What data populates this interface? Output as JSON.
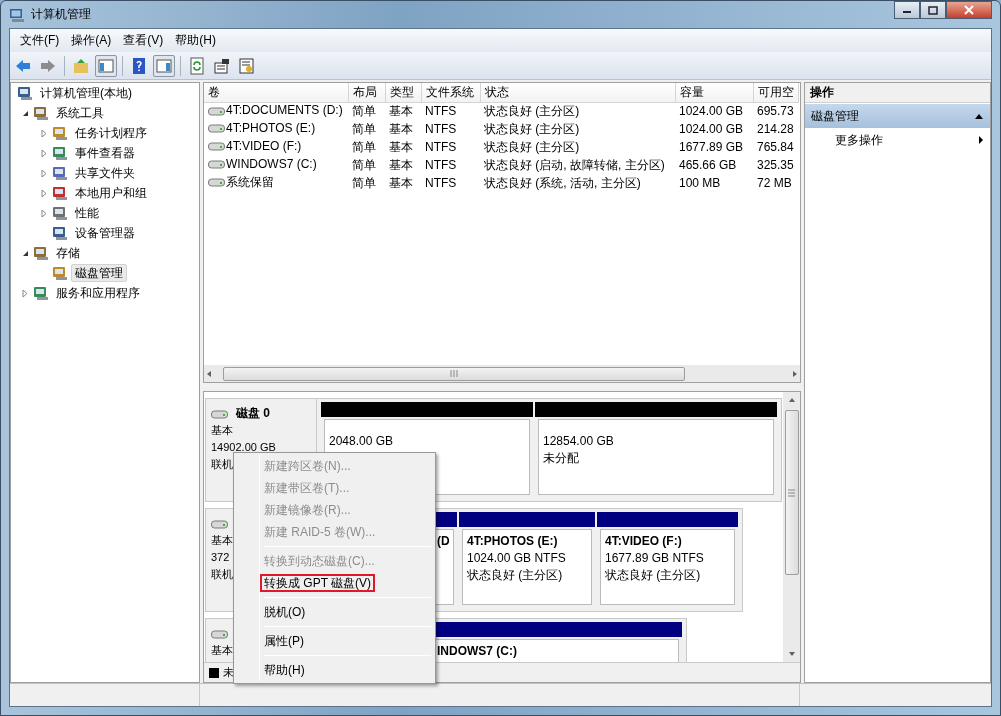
{
  "window": {
    "title": "计算机管理"
  },
  "menu_bar": [
    {
      "label": "文件(F)"
    },
    {
      "label": "操作(A)"
    },
    {
      "label": "查看(V)"
    },
    {
      "label": "帮助(H)"
    }
  ],
  "toolbar": [
    {
      "kind": "back",
      "pressed": false
    },
    {
      "kind": "forward",
      "pressed": false
    },
    {
      "kind": "sep"
    },
    {
      "kind": "up",
      "pressed": false
    },
    {
      "kind": "tree",
      "pressed": true
    },
    {
      "kind": "sep"
    },
    {
      "kind": "help",
      "pressed": false
    },
    {
      "kind": "pane",
      "pressed": true
    },
    {
      "kind": "sep"
    },
    {
      "kind": "refresh",
      "pressed": false
    },
    {
      "kind": "properties",
      "pressed": false
    },
    {
      "kind": "export",
      "pressed": false
    }
  ],
  "tree": [
    {
      "label": "计算机管理(本地)",
      "kind": "root",
      "selected": false,
      "children": [
        {
          "label": "系统工具",
          "kind": "branch",
          "expanded": true,
          "selected": false,
          "children": [
            {
              "label": "任务计划程序",
              "kind": "branch",
              "expanded": false,
              "selected": false
            },
            {
              "label": "事件查看器",
              "kind": "branch",
              "expanded": false,
              "selected": false
            },
            {
              "label": "共享文件夹",
              "kind": "branch",
              "expanded": false,
              "selected": false
            },
            {
              "label": "本地用户和组",
              "kind": "branch",
              "expanded": false,
              "selected": false
            },
            {
              "label": "性能",
              "kind": "branch",
              "expanded": false,
              "selected": false
            },
            {
              "label": "设备管理器",
              "kind": "leaf",
              "expanded": false,
              "selected": false
            }
          ]
        },
        {
          "label": "存储",
          "kind": "branch",
          "expanded": true,
          "selected": false,
          "children": [
            {
              "label": "磁盘管理",
              "kind": "leaf",
              "expanded": false,
              "selected": true
            }
          ]
        },
        {
          "label": "服务和应用程序",
          "kind": "branch",
          "expanded": false,
          "selected": false
        }
      ]
    }
  ],
  "volumes": {
    "columns": [
      "卷",
      "布局",
      "类型",
      "文件系统",
      "状态",
      "容量",
      "可用空"
    ],
    "rows": [
      {
        "cells": [
          "4T:DOCUMENTS (D:)",
          "简单",
          "基本",
          "NTFS",
          "状态良好 (主分区)",
          "1024.00 GB",
          "695.73"
        ]
      },
      {
        "cells": [
          "4T:PHOTOS (E:)",
          "简单",
          "基本",
          "NTFS",
          "状态良好 (主分区)",
          "1024.00 GB",
          "214.28"
        ]
      },
      {
        "cells": [
          "4T:VIDEO (F:)",
          "简单",
          "基本",
          "NTFS",
          "状态良好 (主分区)",
          "1677.89 GB",
          "765.84"
        ]
      },
      {
        "cells": [
          "WINDOWS7 (C:)",
          "简单",
          "基本",
          "NTFS",
          "状态良好 (启动, 故障转储, 主分区)",
          "465.66 GB",
          "325.35"
        ]
      },
      {
        "cells": [
          "系统保留",
          "简单",
          "基本",
          "NTFS",
          "状态良好 (系统, 活动, 主分区)",
          "100 MB",
          "72 MB"
        ]
      }
    ]
  },
  "disks": [
    {
      "name": "磁盘 0",
      "lines": [
        "基本",
        "14902.00 GB",
        "联机"
      ],
      "partitions": [
        {
          "kind": "unallocated",
          "covered": false,
          "lines": [
            "2048.00 GB"
          ]
        },
        {
          "kind": "unallocated",
          "covered": false,
          "lines": [
            "12854.00 GB",
            "未分配"
          ]
        }
      ]
    },
    {
      "lines": [
        "基本",
        "372",
        "联机"
      ],
      "partitions": [
        {
          "kind": "primary",
          "covered": true,
          "title": "(D"
        },
        {
          "kind": "primary",
          "covered": false,
          "title": "4T:PHOTOS  (E:)",
          "lines": [
            "1024.00 GB NTFS",
            "状态良好 (主分区)"
          ]
        },
        {
          "kind": "primary",
          "covered": false,
          "title": "4T:VIDEO  (F:)",
          "lines": [
            "1677.89 GB NTFS",
            "状态良好 (主分区)"
          ]
        }
      ]
    },
    {
      "lines": [
        "基本"
      ],
      "partitions": [
        {
          "kind": "primary",
          "covered": true,
          "title": "INDOWS7  (C:)"
        }
      ]
    }
  ],
  "legend": [
    {
      "label": "未",
      "color": "#000000"
    }
  ],
  "context_menu": [
    {
      "kind": "item",
      "label": "新建跨区卷(N)...",
      "disabled": true,
      "highlighted": false
    },
    {
      "kind": "item",
      "label": "新建带区卷(T)...",
      "disabled": true,
      "highlighted": false
    },
    {
      "kind": "item",
      "label": "新建镜像卷(R)...",
      "disabled": true,
      "highlighted": false
    },
    {
      "kind": "item",
      "label": "新建 RAID-5 卷(W)...",
      "disabled": true,
      "highlighted": false
    },
    {
      "kind": "separator"
    },
    {
      "kind": "item",
      "label": "转换到动态磁盘(C)...",
      "disabled": true,
      "highlighted": false
    },
    {
      "kind": "item",
      "label": "转换成 GPT 磁盘(V)",
      "disabled": false,
      "highlighted": true
    },
    {
      "kind": "separator"
    },
    {
      "kind": "item",
      "label": "脱机(O)",
      "disabled": false,
      "highlighted": false
    },
    {
      "kind": "separator"
    },
    {
      "kind": "item",
      "label": "属性(P)",
      "disabled": false,
      "highlighted": false
    },
    {
      "kind": "separator"
    },
    {
      "kind": "item",
      "label": "帮助(H)",
      "disabled": false,
      "highlighted": false
    }
  ],
  "actions": {
    "title": "操作",
    "sections": [
      {
        "label": "磁盘管理",
        "expanded": true,
        "items": [
          {
            "label": "更多操作"
          }
        ]
      }
    ]
  }
}
